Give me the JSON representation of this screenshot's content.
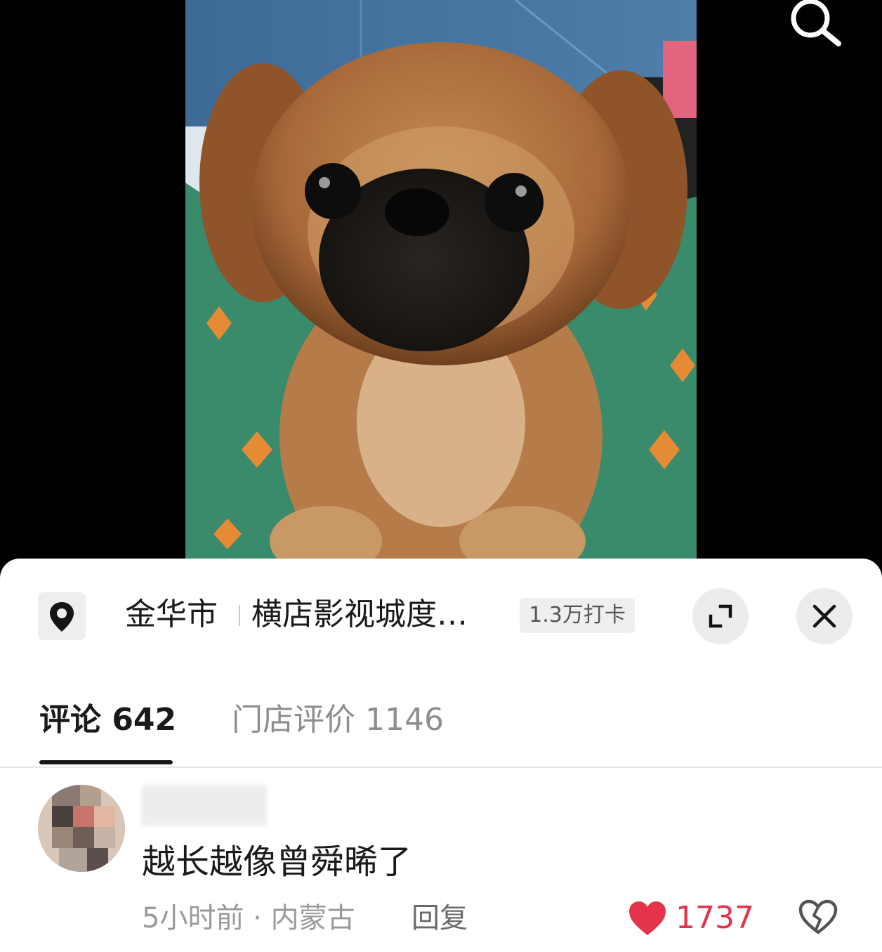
{
  "location": {
    "city": "金华市",
    "name": "横店影视城度…",
    "checkins": "1.3万打卡"
  },
  "tabs": {
    "comments": "评论 642",
    "reviews": "门店评价 1146"
  },
  "comment": {
    "text": "越长越像曾舜晞了",
    "meta": "5小时前 · 内蒙古",
    "reply_label": "回复",
    "likes": "1737"
  },
  "colors": {
    "like_red": "#e3344b",
    "sheet_bg": "#ffffff",
    "video_bg": "#000000"
  }
}
